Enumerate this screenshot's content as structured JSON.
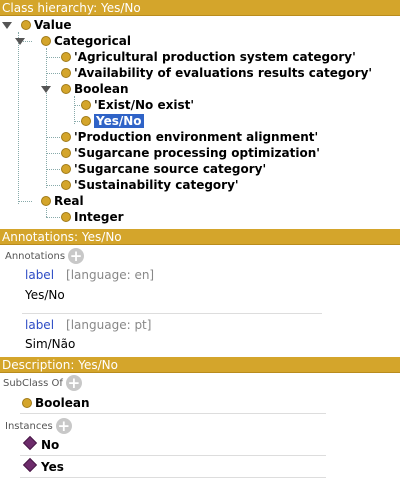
{
  "class_hierarchy": {
    "header": "Class hierarchy: Yes/No",
    "nodes": [
      {
        "label": "Value"
      },
      {
        "label": "Categorical"
      },
      {
        "label": "'Agricultural production system category'"
      },
      {
        "label": "'Availability of evaluations results category'"
      },
      {
        "label": "Boolean"
      },
      {
        "label": "'Exist/No exist'"
      },
      {
        "label": "Yes/No",
        "selected": true
      },
      {
        "label": "'Production environment alignment'"
      },
      {
        "label": "'Sugarcane processing optimization'"
      },
      {
        "label": "'Sugarcane source category'"
      },
      {
        "label": "'Sustainability category'"
      },
      {
        "label": "Real"
      },
      {
        "label": "Integer"
      }
    ]
  },
  "annotations": {
    "header": "Annotations: Yes/No",
    "section_label": "Annotations",
    "items": [
      {
        "property": "label",
        "lang": "[language: en]",
        "value": "Yes/No"
      },
      {
        "property": "label",
        "lang": "[language: pt]",
        "value": "Sim/Não"
      }
    ]
  },
  "description": {
    "header": "Description: Yes/No",
    "subclass_label": "SubClass Of",
    "subclass_of": "Boolean",
    "instances_label": "Instances",
    "instances": [
      "No",
      "Yes"
    ]
  },
  "colors": {
    "accent": "#d4a52b",
    "selection": "#2f63c7",
    "instance": "#6d2b6b",
    "link": "#2c4bc5"
  },
  "icons": {
    "class": "class-circle-icon",
    "instance": "individual-diamond-icon",
    "add": "add-circle-icon"
  }
}
